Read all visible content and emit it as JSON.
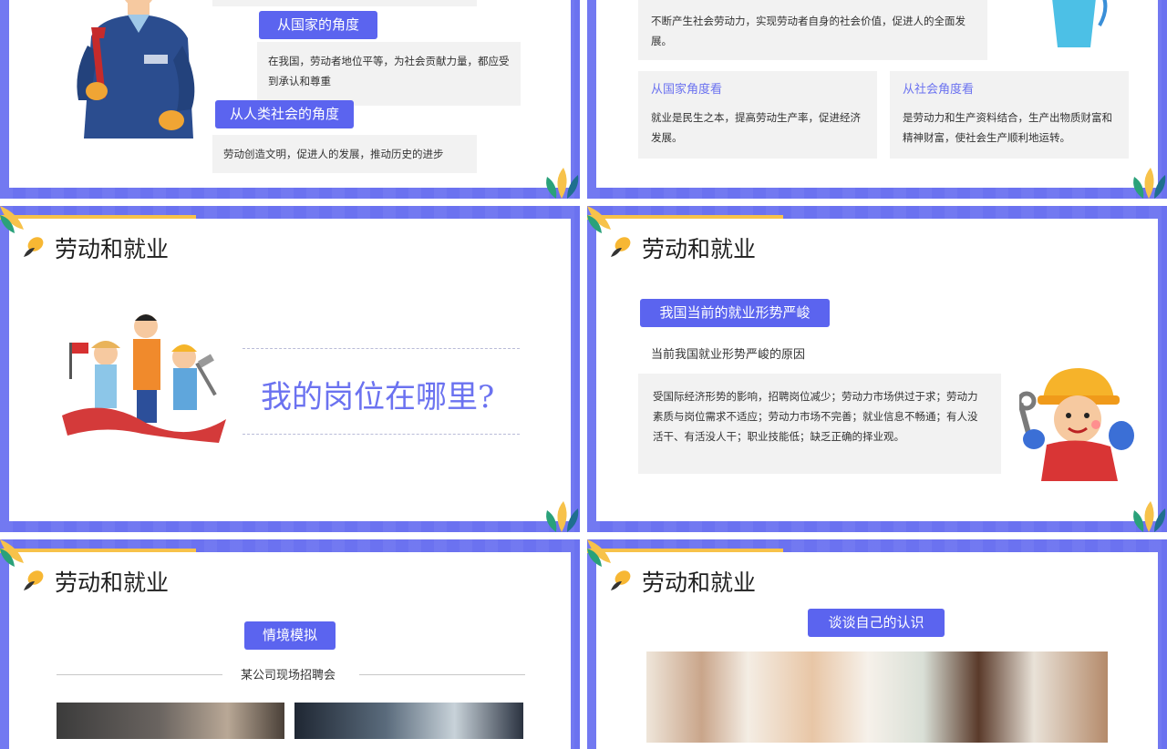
{
  "colors": {
    "accent": "#6b72f0",
    "pill": "#5b64ef",
    "yellow": "#f7c24a",
    "box": "#f2f2f2"
  },
  "slide1": {
    "pill_state": "从国家的角度",
    "text_state": "在我国，劳动者地位平等，为社会贡献力量，都应受到承认和尊重",
    "pill_human": "从人类社会的角度",
    "text_human": "劳动创造文明，促进人的发展，推动历史的进步"
  },
  "slide2": {
    "top_text": "不断产生社会劳动力，实现劳动者自身的社会价值，促进人的全面发展。",
    "state_label": "从国家角度看",
    "state_text": "就业是民生之本，提高劳动生产率，促进经济发展。",
    "society_label": "从社会角度看",
    "society_text": "是劳动力和生产资料结合，生产出物质财富和精神财富，使社会生产顺利地运转。"
  },
  "slide3": {
    "title": "劳动和就业",
    "question": "我的岗位在哪里?"
  },
  "slide4": {
    "title": "劳动和就业",
    "pill": "我国当前的就业形势严峻",
    "subtitle": "当前我国就业形势严峻的原因",
    "box_text": "受国际经济形势的影响，招聘岗位减少；劳动力市场供过于求；劳动力素质与岗位需求不适应；劳动力市场不完善；就业信息不畅通；有人没活干、有活没人干；职业技能低；缺乏正确的择业观。"
  },
  "slide5": {
    "title": "劳动和就业",
    "pill": "情境模拟",
    "subtitle": "某公司现场招聘会"
  },
  "slide6": {
    "title": "劳动和就业",
    "pill": "谈谈自己的认识"
  }
}
